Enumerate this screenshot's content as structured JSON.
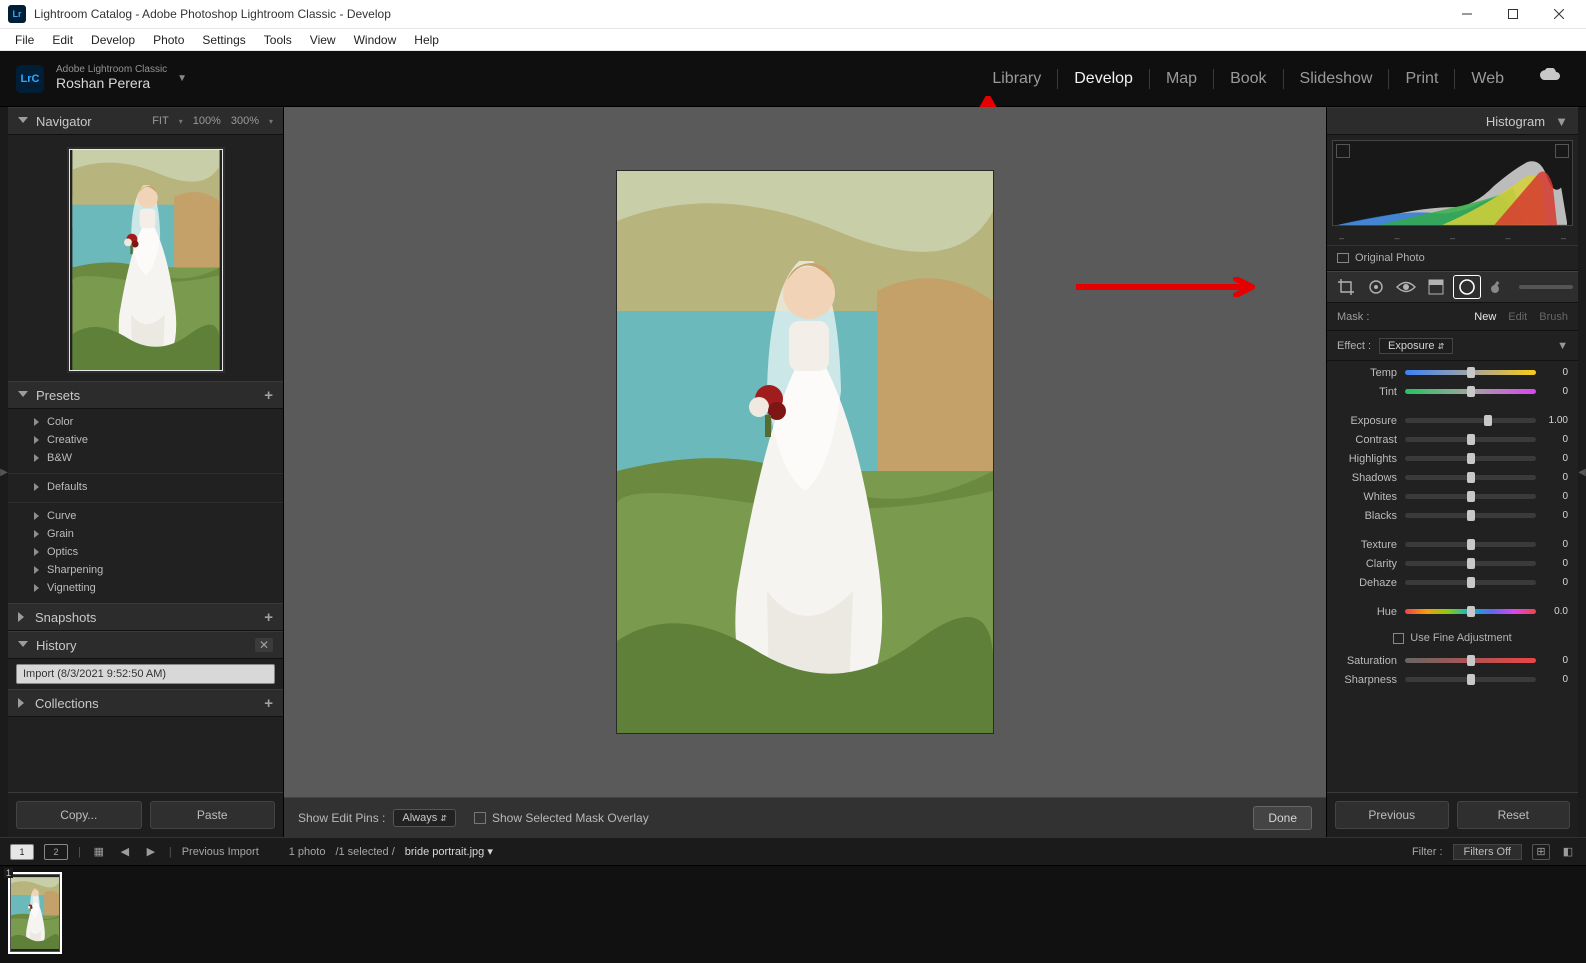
{
  "window": {
    "title": "Lightroom Catalog - Adobe Photoshop Lightroom Classic - Develop"
  },
  "menu": [
    "File",
    "Edit",
    "Develop",
    "Photo",
    "Settings",
    "Tools",
    "View",
    "Window",
    "Help"
  ],
  "identity": {
    "brand": "LrC",
    "product": "Adobe Lightroom Classic",
    "user": "Roshan Perera"
  },
  "modules": [
    "Library",
    "Develop",
    "Map",
    "Book",
    "Slideshow",
    "Print",
    "Web"
  ],
  "active_module": "Develop",
  "navigator": {
    "title": "Navigator",
    "zoom_opts": [
      "FIT",
      "100%",
      "300%"
    ]
  },
  "presets": {
    "title": "Presets",
    "groups_top": [
      "Color",
      "Creative",
      "B&W"
    ],
    "group_defaults": "Defaults",
    "groups_bottom": [
      "Curve",
      "Grain",
      "Optics",
      "Sharpening",
      "Vignetting"
    ]
  },
  "snapshots": {
    "title": "Snapshots"
  },
  "history": {
    "title": "History",
    "entry": "Import (8/3/2021 9:52:50 AM)"
  },
  "collections": {
    "title": "Collections"
  },
  "left_buttons": {
    "copy": "Copy...",
    "paste": "Paste"
  },
  "center_toolbar": {
    "pins_label": "Show Edit Pins :",
    "pins_value": "Always",
    "overlay_label": "Show Selected Mask Overlay",
    "done": "Done"
  },
  "histogram": {
    "title": "Histogram"
  },
  "original": {
    "label": "Original Photo"
  },
  "tools": [
    "crop",
    "spot",
    "redeye",
    "mask-gradient",
    "mask-radial",
    "brush"
  ],
  "selected_tool": "mask-radial",
  "mask_row": {
    "label": "Mask :",
    "new": "New",
    "edit": "Edit",
    "brush": "Brush"
  },
  "effect_row": {
    "label": "Effect :",
    "value": "Exposure"
  },
  "sliders": [
    {
      "name": "Temp",
      "value": "0",
      "knob": 50,
      "track": "temp"
    },
    {
      "name": "Tint",
      "value": "0",
      "knob": 50,
      "track": "tint"
    },
    {
      "name": "_gap"
    },
    {
      "name": "Exposure",
      "value": "1.00",
      "knob": 63,
      "track": "plain"
    },
    {
      "name": "Contrast",
      "value": "0",
      "knob": 50,
      "track": "plain"
    },
    {
      "name": "Highlights",
      "value": "0",
      "knob": 50,
      "track": "plain"
    },
    {
      "name": "Shadows",
      "value": "0",
      "knob": 50,
      "track": "plain"
    },
    {
      "name": "Whites",
      "value": "0",
      "knob": 50,
      "track": "plain"
    },
    {
      "name": "Blacks",
      "value": "0",
      "knob": 50,
      "track": "plain"
    },
    {
      "name": "_gap"
    },
    {
      "name": "Texture",
      "value": "0",
      "knob": 50,
      "track": "plain"
    },
    {
      "name": "Clarity",
      "value": "0",
      "knob": 50,
      "track": "plain"
    },
    {
      "name": "Dehaze",
      "value": "0",
      "knob": 50,
      "track": "plain"
    },
    {
      "name": "_gap"
    },
    {
      "name": "Hue",
      "value": "0.0",
      "knob": 50,
      "track": "hue"
    }
  ],
  "fine_adj": "Use Fine Adjustment",
  "sliders_tail": [
    {
      "name": "Saturation",
      "value": "0",
      "knob": 50,
      "track": "sat"
    },
    {
      "name": "Sharpness",
      "value": "0",
      "knob": 50,
      "track": "plain"
    }
  ],
  "right_buttons": {
    "prev": "Previous",
    "reset": "Reset"
  },
  "infobar": {
    "screen1": "1",
    "screen2": "2",
    "source": "Previous Import",
    "count": "1 photo",
    "selected": "/1 selected /",
    "filename": "bride portrait.jpg",
    "filter_label": "Filter :",
    "filter_value": "Filters Off"
  }
}
